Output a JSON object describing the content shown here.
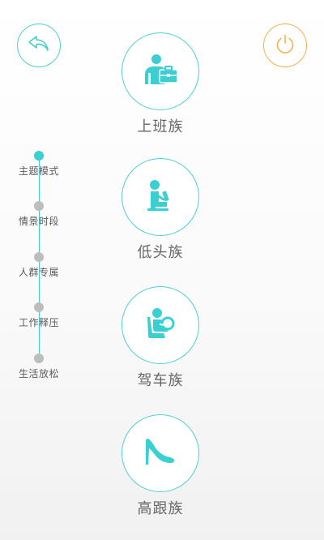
{
  "colors": {
    "accent": "#43cdd1",
    "power": "#f6b04d",
    "inactive": "#bdbdbd",
    "text": "#666666"
  },
  "header": {
    "back_icon": "back-arrow-icon",
    "power_icon": "power-icon"
  },
  "timeline": {
    "items": [
      {
        "label": "主题模式",
        "active": true
      },
      {
        "label": "情景时段",
        "active": false
      },
      {
        "label": "人群专属",
        "active": false
      },
      {
        "label": "工作释压",
        "active": false
      },
      {
        "label": "生活放松",
        "active": false
      }
    ]
  },
  "modes": [
    {
      "label": "上班族",
      "icon": "office-worker-icon"
    },
    {
      "label": "低头族",
      "icon": "phone-user-icon"
    },
    {
      "label": "驾车族",
      "icon": "driver-icon"
    },
    {
      "label": "高跟族",
      "icon": "high-heel-icon"
    }
  ]
}
